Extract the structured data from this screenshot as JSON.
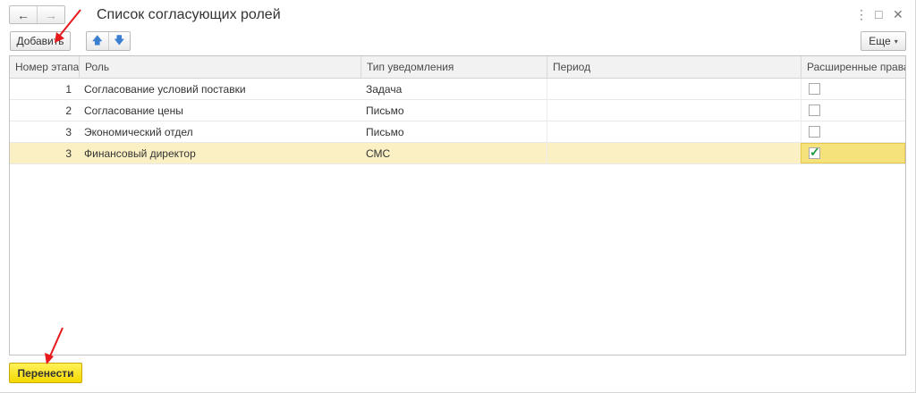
{
  "window": {
    "title": "Список согласующих ролей",
    "menu_icon": "⋮",
    "restore_icon": "□",
    "close_icon": "✕"
  },
  "nav": {
    "back": "←",
    "forward": "→"
  },
  "toolbar": {
    "add_label": "Добавить",
    "move_up": "🡅",
    "move_down": "🡇",
    "more_label": "Еще",
    "more_caret": "▾"
  },
  "table": {
    "columns": [
      "Номер этапа",
      "Роль",
      "Тип уведомления",
      "Период",
      "Расширенные права"
    ],
    "rows": [
      {
        "stage": "1",
        "role": "Согласование условий поставки",
        "notify": "Задача",
        "period": "",
        "extended": false
      },
      {
        "stage": "2",
        "role": "Согласование цены",
        "notify": "Письмо",
        "period": "",
        "extended": false
      },
      {
        "stage": "3",
        "role": "Экономический отдел",
        "notify": "Письмо",
        "period": "",
        "extended": false
      },
      {
        "stage": "3",
        "role": "Финансовый директор",
        "notify": "СМС",
        "period": "",
        "extended": true
      }
    ]
  },
  "footer": {
    "transfer_label": "Перенести"
  },
  "colors": {
    "accent_yellow": "#f5d800",
    "selection": "#fbf0c3",
    "annotation": "#e8191d"
  }
}
